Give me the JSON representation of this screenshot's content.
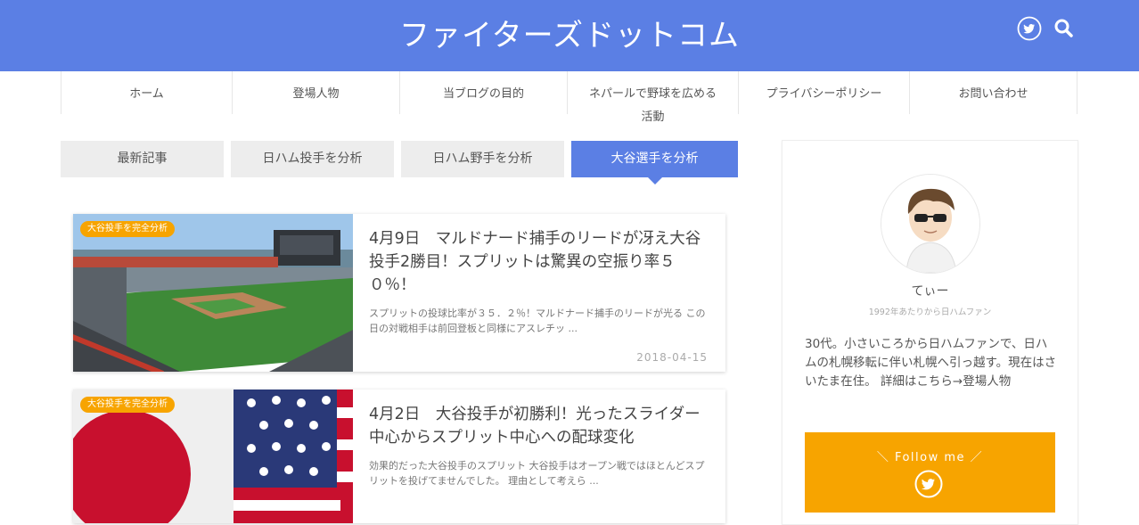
{
  "site": {
    "title": "ファイターズドットコム",
    "icons": [
      "twitter-icon",
      "search-icon"
    ]
  },
  "nav": {
    "items": [
      {
        "label": "ホーム"
      },
      {
        "label": "登場人物"
      },
      {
        "label": "当ブログの目的"
      },
      {
        "label": "ネパールで野球を広める活動"
      },
      {
        "label": "プライバシーポリシー"
      },
      {
        "label": "お問い合わせ"
      }
    ]
  },
  "tabs": {
    "items": [
      {
        "label": "最新記事",
        "active": false
      },
      {
        "label": "日ハム投手を分析",
        "active": false
      },
      {
        "label": "日ハム野手を分析",
        "active": false
      },
      {
        "label": "大谷選手を分析",
        "active": true
      }
    ]
  },
  "articles": [
    {
      "badge": "大谷投手を完全分析",
      "title": "4月9日　マルドナード捕手のリードが冴え大谷投手2勝目！スプリットは驚異の空振り率５０％！",
      "snippet": "スプリットの投球比率が３５．２％！マルドナード捕手のリードが光る この日の対戦相手は前回登板と同様にアスレチッ ...",
      "date": "2018-04-15"
    },
    {
      "badge": "大谷投手を完全分析",
      "title": "4月2日　大谷投手が初勝利！光ったスライダー中心からスプリット中心への配球変化",
      "snippet": "効果的だった大谷投手のスプリット 大谷投手はオープン戦ではほとんどスプリットを投げてませんでした。 理由として考えら ...",
      "date": ""
    }
  ],
  "sidebar": {
    "name": "てぃー",
    "sub": "1992年あたりから日ハムファン",
    "description": "30代。小さいころから日ハムファンで、日ハムの札幌移転に伴い札幌へ引っ越す。現在はさいたま在住。 詳細はこちら→登場人物",
    "follow_label": "＼ Follow me ／"
  },
  "colors": {
    "brand": "#5b7fe4",
    "accent": "#f7a400"
  }
}
